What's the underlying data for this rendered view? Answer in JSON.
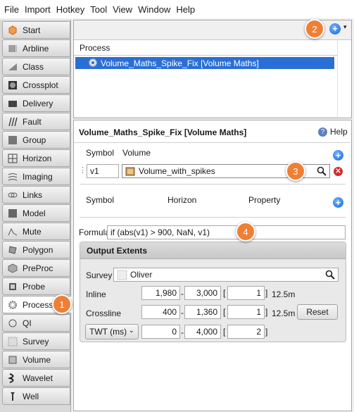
{
  "menu": [
    "File",
    "Import",
    "Hotkey",
    "Tool",
    "View",
    "Window",
    "Help"
  ],
  "sidebar": [
    {
      "label": "Start",
      "icon": "start-icon"
    },
    {
      "label": "Arbline",
      "icon": "arbline-icon"
    },
    {
      "label": "Class",
      "icon": "class-icon"
    },
    {
      "label": "Crossplot",
      "icon": "crossplot-icon"
    },
    {
      "label": "Delivery",
      "icon": "delivery-icon"
    },
    {
      "label": "Fault",
      "icon": "fault-icon"
    },
    {
      "label": "Group",
      "icon": "group-icon"
    },
    {
      "label": "Horizon",
      "icon": "horizon-icon"
    },
    {
      "label": "Imaging",
      "icon": "imaging-icon"
    },
    {
      "label": "Links",
      "icon": "links-icon"
    },
    {
      "label": "Model",
      "icon": "model-icon"
    },
    {
      "label": "Mute",
      "icon": "mute-icon"
    },
    {
      "label": "Polygon",
      "icon": "polygon-icon"
    },
    {
      "label": "PreProc",
      "icon": "preproc-icon"
    },
    {
      "label": "Probe",
      "icon": "probe-icon"
    },
    {
      "label": "Process",
      "icon": "process-gear-icon",
      "active": true
    },
    {
      "label": "QI",
      "icon": "qi-icon"
    },
    {
      "label": "Survey",
      "icon": "survey-icon"
    },
    {
      "label": "Volume",
      "icon": "volume-icon"
    },
    {
      "label": "Wavelet",
      "icon": "wavelet-icon"
    },
    {
      "label": "Well",
      "icon": "well-icon"
    }
  ],
  "process_table": {
    "header": "Process",
    "rows": [
      "Volume_Maths_Spike_Fix [Volume Maths]"
    ]
  },
  "panel": {
    "title": "Volume_Maths_Spike_Fix [Volume Maths]",
    "help_label": "Help",
    "volume_headers": {
      "symbol": "Symbol",
      "volume": "Volume"
    },
    "volume_row": {
      "symbol": "v1",
      "volume": "Volume_with_spikes"
    },
    "horizon_headers": {
      "symbol": "Symbol",
      "horizon": "Horizon",
      "property": "Property"
    },
    "formula_label": "Formula",
    "formula_value": "if (abs(v1) > 900, NaN, v1)"
  },
  "output_extents": {
    "title": "Output Extents",
    "survey_label": "Survey",
    "survey_value": "Oliver",
    "inline": {
      "label": "Inline",
      "from": "1,980",
      "to": "3,000",
      "step": "1",
      "unit": "12.5m"
    },
    "crossline": {
      "label": "Crossline",
      "from": "400",
      "to": "1,360",
      "step": "1",
      "unit": "12.5m"
    },
    "twt": {
      "label": "TWT (ms)",
      "from": "0",
      "to": "4,000",
      "step": "2"
    },
    "dash": "-",
    "open_bracket": "[",
    "close_bracket": "]",
    "reset_label": "Reset"
  },
  "badges": [
    "1",
    "2",
    "3",
    "4"
  ],
  "colors": {
    "selection": "#2a6fd6",
    "badge": "#f07f36",
    "add": "#1565d8",
    "delete": "#d82a2a"
  }
}
